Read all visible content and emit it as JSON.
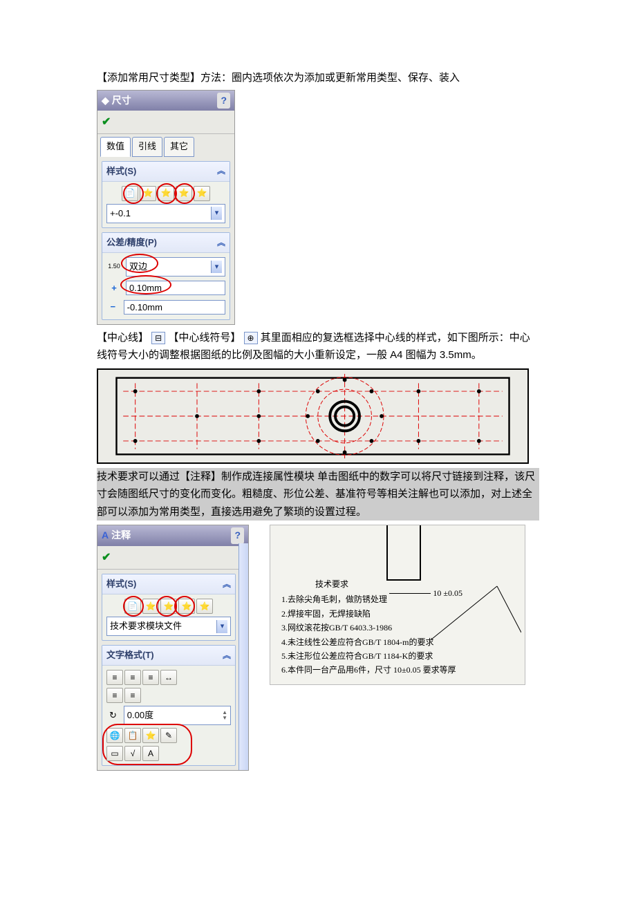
{
  "intro": "【添加常用尺寸类型】方法：圈内选项依次为添加或更新常用类型、保存、装入",
  "dim_panel": {
    "title": "尺寸",
    "tabs": [
      "数值",
      "引线",
      "其它"
    ],
    "group_style": "样式(S)",
    "style_value": "+-0.1",
    "group_tol": "公差/精度(P)",
    "tol_type": "双边",
    "tol_plus": "0.10mm",
    "tol_minus": "-0.10mm",
    "tol_prefix": "1.50"
  },
  "centerline_text_a": "【中心线】",
  "centerline_text_b": "【中心线符号】",
  "centerline_text_c": "其里面相应的复选框选择中心线的样式，如下图所示：中心线符号大小的调整根据图纸的比例及图幅的大小重新设定，一般 A4 图幅为 3.5mm。",
  "req_para": "技术要求可以通过【注释】制作成连接属性模块 单击图纸中的数字可以将尺寸链接到注释，该尺寸会随图纸尺寸的变化而变化。粗糙度、形位公差、基准符号等相关注解也可以添加，对上述全部可以添加为常用类型，直接选用避免了繁琐的设置过程。",
  "annot_panel": {
    "title": "注释",
    "group_style": "样式(S)",
    "style_value": "技术要求模块文件",
    "group_fmt": "文字格式(T)",
    "angle": "0.00度"
  },
  "tech": {
    "dim_label": "10 ±0.05",
    "title": "技术要求",
    "items": [
      "1.去除尖角毛刺，做防锈处理",
      "2.焊接牢固，无焊接缺陷",
      "3.网纹滚花按GB/T 6403.3-1986",
      "4.未注线性公差应符合GB/T 1804-m的要求",
      "5.未注形位公差应符合GB/T 1184-K的要求",
      "6.本件同一台产品用6件，尺寸 10±0.05 要求等厚"
    ]
  }
}
